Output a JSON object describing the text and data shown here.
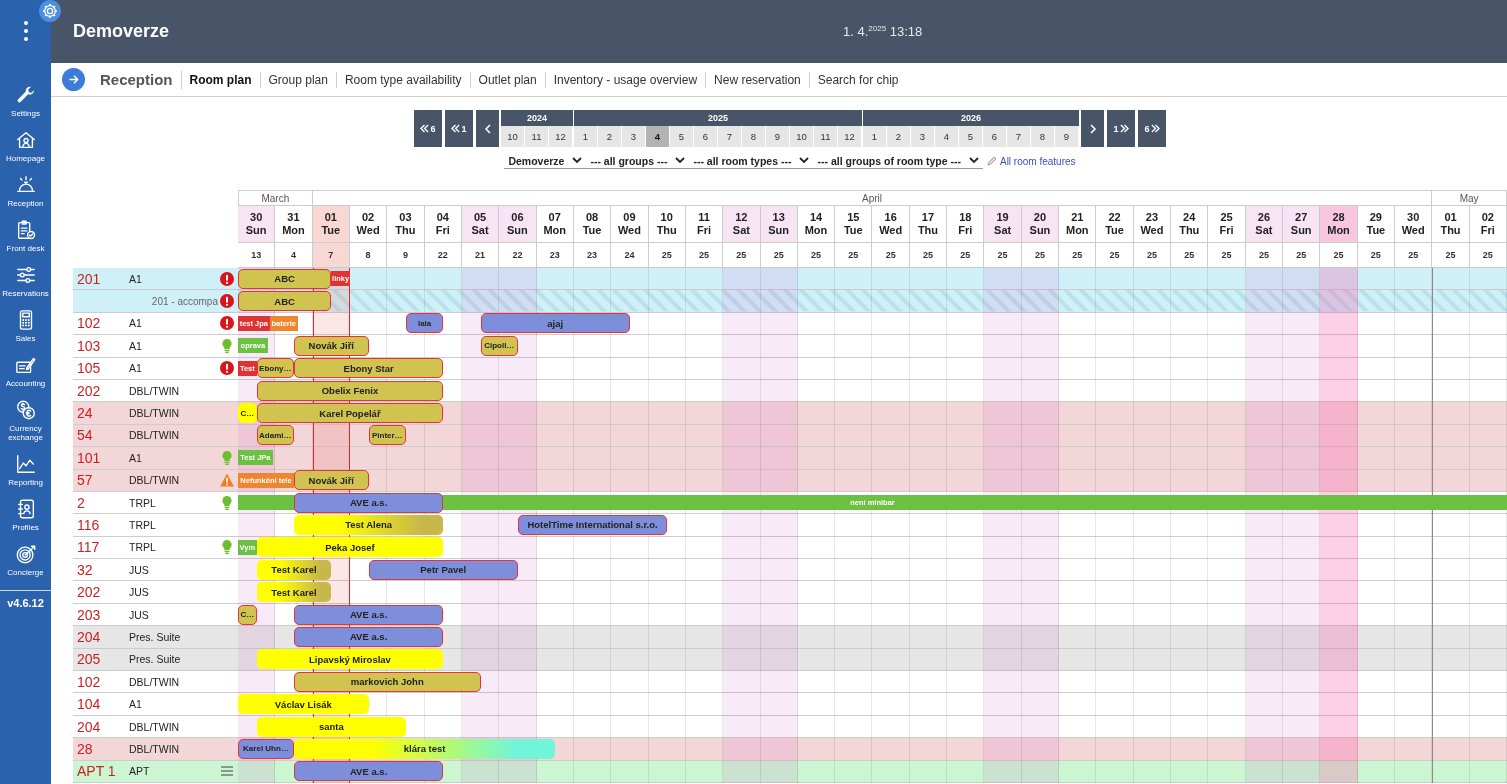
{
  "sidebar": {
    "items": [
      {
        "label": "Settings"
      },
      {
        "label": "Homepage"
      },
      {
        "label": "Reception"
      },
      {
        "label": "Front desk"
      },
      {
        "label": "Reservations"
      },
      {
        "label": "Sales"
      },
      {
        "label": "Accounting"
      },
      {
        "label": "Currency exchange"
      },
      {
        "label": "Reporting"
      },
      {
        "label": "Profiles"
      },
      {
        "label": "Concierge"
      }
    ],
    "version": "v4.6.12"
  },
  "header": {
    "title": "Demoverze",
    "clock": "1. 4.$^{2025}$ 13:18"
  },
  "nav": {
    "section": "Reception",
    "tabs": [
      {
        "label": "Room plan",
        "selected": true
      },
      {
        "label": "Group plan",
        "selected": false
      },
      {
        "label": "Room type availability",
        "selected": false
      },
      {
        "label": "Outlet plan",
        "selected": false
      },
      {
        "label": "Inventory - usage overview",
        "selected": false
      },
      {
        "label": "New reservation",
        "selected": false
      },
      {
        "label": "Search for chip",
        "selected": false
      }
    ]
  },
  "picker": {
    "back": [
      {
        "kind": "jump",
        "label": "6"
      },
      {
        "kind": "jump",
        "label": "1"
      },
      {
        "kind": "step"
      }
    ],
    "years": [
      {
        "year": "2024",
        "months": [
          {
            "label": "10",
            "selected": false
          },
          {
            "label": "11",
            "selected": false
          },
          {
            "label": "12",
            "selected": false
          }
        ]
      },
      {
        "year": "2025",
        "months": [
          {
            "label": "1",
            "selected": false
          },
          {
            "label": "2",
            "selected": false
          },
          {
            "label": "3",
            "selected": false
          },
          {
            "label": "4",
            "selected": true
          },
          {
            "label": "5",
            "selected": false
          },
          {
            "label": "6",
            "selected": false
          },
          {
            "label": "7",
            "selected": false
          },
          {
            "label": "8",
            "selected": false
          },
          {
            "label": "9",
            "selected": false
          },
          {
            "label": "10",
            "selected": false
          },
          {
            "label": "11",
            "selected": false
          },
          {
            "label": "12",
            "selected": false
          }
        ]
      },
      {
        "year": "2026",
        "months": [
          {
            "label": "1",
            "selected": false
          },
          {
            "label": "2",
            "selected": false
          },
          {
            "label": "3",
            "selected": false
          },
          {
            "label": "4",
            "selected": false
          },
          {
            "label": "5",
            "selected": false
          },
          {
            "label": "6",
            "selected": false
          },
          {
            "label": "7",
            "selected": false
          },
          {
            "label": "8",
            "selected": false
          },
          {
            "label": "9",
            "selected": false
          }
        ]
      }
    ],
    "forward": [
      {
        "kind": "step"
      },
      {
        "kind": "jump",
        "label": "1"
      },
      {
        "kind": "jump",
        "label": "6"
      }
    ]
  },
  "filters": {
    "dropdowns": [
      {
        "value": "Demoverze"
      },
      {
        "value": "--- all groups ---"
      },
      {
        "value": "--- all room types ---"
      },
      {
        "value": "--- all groups of room type ---"
      }
    ],
    "features_link": "All room features"
  },
  "grid": {
    "months": [
      {
        "name": "March",
        "days": [
          {
            "day": "30",
            "weekday": "Sun",
            "count": "13",
            "kind": "weekend"
          },
          {
            "day": "31",
            "weekday": "Mon",
            "count": "4",
            "kind": "weekday"
          }
        ]
      },
      {
        "name": "April",
        "days": [
          {
            "day": "01",
            "weekday": "Tue",
            "count": "7",
            "kind": "today"
          },
          {
            "day": "02",
            "weekday": "Wed",
            "count": "8",
            "kind": "weekday"
          },
          {
            "day": "03",
            "weekday": "Thu",
            "count": "9",
            "kind": "weekday"
          },
          {
            "day": "04",
            "weekday": "Fri",
            "count": "22",
            "kind": "weekday"
          },
          {
            "day": "05",
            "weekday": "Sat",
            "count": "21",
            "kind": "weekend"
          },
          {
            "day": "06",
            "weekday": "Sun",
            "count": "22",
            "kind": "weekend"
          },
          {
            "day": "07",
            "weekday": "Mon",
            "count": "23",
            "kind": "weekday"
          },
          {
            "day": "08",
            "weekday": "Tue",
            "count": "23",
            "kind": "weekday"
          },
          {
            "day": "09",
            "weekday": "Wed",
            "count": "24",
            "kind": "weekday"
          },
          {
            "day": "10",
            "weekday": "Thu",
            "count": "25",
            "kind": "weekday"
          },
          {
            "day": "11",
            "weekday": "Fri",
            "count": "25",
            "kind": "weekday"
          },
          {
            "day": "12",
            "weekday": "Sat",
            "count": "25",
            "kind": "weekend"
          },
          {
            "day": "13",
            "weekday": "Sun",
            "count": "25",
            "kind": "weekend"
          },
          {
            "day": "14",
            "weekday": "Mon",
            "count": "25",
            "kind": "weekday"
          },
          {
            "day": "15",
            "weekday": "Tue",
            "count": "25",
            "kind": "weekday"
          },
          {
            "day": "16",
            "weekday": "Wed",
            "count": "25",
            "kind": "weekday"
          },
          {
            "day": "17",
            "weekday": "Thu",
            "count": "25",
            "kind": "weekday"
          },
          {
            "day": "18",
            "weekday": "Fri",
            "count": "25",
            "kind": "weekday"
          },
          {
            "day": "19",
            "weekday": "Sat",
            "count": "25",
            "kind": "weekend"
          },
          {
            "day": "20",
            "weekday": "Sun",
            "count": "25",
            "kind": "weekend"
          },
          {
            "day": "21",
            "weekday": "Mon",
            "count": "25",
            "kind": "weekday"
          },
          {
            "day": "22",
            "weekday": "Tue",
            "count": "25",
            "kind": "weekday"
          },
          {
            "day": "23",
            "weekday": "Wed",
            "count": "25",
            "kind": "weekday"
          },
          {
            "day": "24",
            "weekday": "Thu",
            "count": "25",
            "kind": "weekday"
          },
          {
            "day": "25",
            "weekday": "Fri",
            "count": "25",
            "kind": "weekday"
          },
          {
            "day": "26",
            "weekday": "Sat",
            "count": "25",
            "kind": "weekend"
          },
          {
            "day": "27",
            "weekday": "Sun",
            "count": "25",
            "kind": "weekend"
          },
          {
            "day": "28",
            "weekday": "Mon",
            "count": "25",
            "kind": "holiday"
          },
          {
            "day": "29",
            "weekday": "Tue",
            "count": "25",
            "kind": "weekday"
          },
          {
            "day": "30",
            "weekday": "Wed",
            "count": "25",
            "kind": "weekday"
          }
        ]
      },
      {
        "name": "May",
        "days": [
          {
            "day": "01",
            "weekday": "Thu",
            "count": "25",
            "kind": "weekday"
          },
          {
            "day": "02",
            "weekday": "Fri",
            "count": "25",
            "kind": "weekday"
          }
        ]
      }
    ]
  },
  "rooms": [
    {
      "kind": "room",
      "number": "201",
      "type": "A1",
      "indicator": {
        "kind": "error"
      },
      "color": "#d0f0f8",
      "bars": [
        {
          "kind": "reservation",
          "label": "ABC",
          "color": "#d0c34f",
          "outlined": true
        },
        {
          "kind": "block",
          "label": "linky",
          "color": "#dd3333"
        }
      ]
    },
    {
      "kind": "accompany",
      "label": "201 - accompa",
      "indicator": {
        "kind": "error"
      },
      "color": "#d0f0f8",
      "bars": [
        {
          "kind": "reservation",
          "label": "ABC",
          "color": "#d0c34f",
          "outlined": true
        }
      ]
    },
    {
      "kind": "room",
      "number": "102",
      "type": "A1",
      "indicator": {
        "kind": "error"
      },
      "color": "#ffffff",
      "bars": [
        {
          "kind": "block",
          "label": "test Jpa",
          "color": "#dd3333"
        },
        {
          "kind": "block",
          "label": "baterie",
          "color": "#f08530"
        },
        {
          "kind": "reservation",
          "label": "lala",
          "color": "#7f8edb",
          "outlined": true
        },
        {
          "kind": "reservation",
          "label": "ajaj",
          "color": "#7f8edb",
          "outlined": true
        }
      ]
    },
    {
      "kind": "room",
      "number": "103",
      "type": "A1",
      "indicator": {
        "kind": "tip"
      },
      "color": "#ffffff",
      "bars": [
        {
          "kind": "block",
          "label": "oprava",
          "color": "#6cc143"
        },
        {
          "kind": "reservation",
          "label": "Novák Jiří",
          "color": "#d0c34f",
          "outlined": true
        },
        {
          "kind": "reservation",
          "label": "Cipoll…",
          "color": "#d0c34f",
          "outlined": true
        }
      ]
    },
    {
      "kind": "room",
      "number": "105",
      "type": "A1",
      "indicator": {
        "kind": "error"
      },
      "color": "#ffffff",
      "bars": [
        {
          "kind": "block",
          "label": "Test",
          "color": "#dd3333"
        },
        {
          "kind": "reservation",
          "label": "Ebony…",
          "color": "#d0c34f",
          "outlined": true
        },
        {
          "kind": "reservation",
          "label": "Ebony Star",
          "color": "#d0c34f",
          "outlined": true
        }
      ]
    },
    {
      "kind": "room",
      "number": "202",
      "type": "DBL/TWIN",
      "color": "#ffffff",
      "bars": [
        {
          "kind": "reservation",
          "label": "Obelix Fenix",
          "color": "#d0c34f",
          "outlined": true
        }
      ]
    },
    {
      "kind": "room",
      "number": "24",
      "type": "DBL/TWIN",
      "color": "#f3d6d7",
      "bars": [
        {
          "kind": "reservation",
          "label": "C…",
          "color": "#ffff00",
          "outlined": false
        },
        {
          "kind": "reservation",
          "label": "Karel Popelář",
          "color": "#d0c34f",
          "outlined": true
        }
      ]
    },
    {
      "kind": "room",
      "number": "54",
      "type": "DBL/TWIN",
      "color": "#f3d6d7",
      "bars": [
        {
          "kind": "reservation",
          "label": "Adami…",
          "color": "#d0c34f",
          "outlined": true
        },
        {
          "kind": "reservation",
          "label": "Pinter…",
          "color": "#d0c34f",
          "outlined": true
        }
      ]
    },
    {
      "kind": "room",
      "number": "101",
      "type": "A1",
      "indicator": {
        "kind": "tip"
      },
      "color": "#f3d6d7",
      "bars": [
        {
          "kind": "block",
          "label": "Test JPa",
          "color": "#6cc143"
        }
      ]
    },
    {
      "kind": "room",
      "number": "57",
      "type": "DBL/TWIN",
      "indicator": {
        "kind": "warning"
      },
      "color": "#f3d6d7",
      "bars": [
        {
          "kind": "block",
          "label": "Nefunkční tele",
          "color": "#f08530"
        },
        {
          "kind": "reservation",
          "label": "Novák Jiří",
          "color": "#d0c34f",
          "outlined": true
        }
      ]
    },
    {
      "kind": "room",
      "number": "2",
      "type": "TRPL",
      "indicator": {
        "kind": "tip"
      },
      "color": "#ffffff",
      "bars": [
        {
          "kind": "reservation",
          "label": "AVE a.s.",
          "color": "#7f8edb",
          "outlined": true
        },
        {
          "kind": "block",
          "label": "není minibar",
          "color": "#6cc143"
        }
      ]
    },
    {
      "kind": "room",
      "number": "116",
      "type": "TRPL",
      "color": "#ffffff",
      "bars": [
        {
          "kind": "reservation",
          "label": "Test Alena",
          "color": "#ffff00",
          "fade": {
            "color": "#c8b84a"
          },
          "outlined": false
        },
        {
          "kind": "reservation",
          "label": "HotelTime International s.r.o.",
          "color": "#7f8edb",
          "outlined": true
        }
      ]
    },
    {
      "kind": "room",
      "number": "117",
      "type": "TRPL",
      "indicator": {
        "kind": "tip"
      },
      "color": "#ffffff",
      "bars": [
        {
          "kind": "block",
          "label": "Vym",
          "color": "#6cc143"
        },
        {
          "kind": "reservation",
          "label": "Peka Josef",
          "color": "#ffff00",
          "outlined": false
        }
      ]
    },
    {
      "kind": "room",
      "number": "32",
      "type": "JUS",
      "color": "#ffffff",
      "bars": [
        {
          "kind": "reservation",
          "label": "Test Karel",
          "color": "#ffff00",
          "fade": {
            "color": "#c8b84a"
          },
          "outlined": false
        },
        {
          "kind": "reservation",
          "label": "Petr Pavel",
          "color": "#7f8edb",
          "outlined": true
        }
      ]
    },
    {
      "kind": "room",
      "number": "202",
      "type": "JUS",
      "color": "#ffffff",
      "bars": [
        {
          "kind": "reservation",
          "label": "Test Karel",
          "color": "#ffff00",
          "fade": {
            "color": "#c8b84a"
          },
          "outlined": false
        }
      ]
    },
    {
      "kind": "room",
      "number": "203",
      "type": "JUS",
      "color": "#ffffff",
      "bars": [
        {
          "kind": "reservation",
          "label": "C…",
          "color": "#d0c34f",
          "outlined": true
        },
        {
          "kind": "reservation",
          "label": "AVE a.s.",
          "color": "#7f8edb",
          "outlined": true
        }
      ]
    },
    {
      "kind": "room",
      "number": "204",
      "type": "Pres. Suite",
      "color": "#e6e6e6",
      "bars": [
        {
          "kind": "reservation",
          "label": "AVE a.s.",
          "color": "#7f8edb",
          "outlined": true
        }
      ]
    },
    {
      "kind": "room",
      "number": "205",
      "type": "Pres. Suite",
      "color": "#e6e6e6",
      "bars": [
        {
          "kind": "reservation",
          "label": "Lipavský Miroslav",
          "color": "#ffff00",
          "outlined": false
        }
      ]
    },
    {
      "kind": "room",
      "number": "102",
      "type": "DBL/TWIN",
      "color": "#ffffff",
      "bars": [
        {
          "kind": "reservation",
          "label": "markovich John",
          "color": "#d0c34f",
          "outlined": true
        }
      ]
    },
    {
      "kind": "room",
      "number": "104",
      "type": "A1",
      "color": "#ffffff",
      "bars": [
        {
          "kind": "reservation",
          "label": "Václav Lisák",
          "color": "#ffff00",
          "outlined": false
        }
      ]
    },
    {
      "kind": "room",
      "number": "204",
      "type": "DBL/TWIN",
      "color": "#ffffff",
      "bars": [
        {
          "kind": "reservation",
          "label": "santa",
          "color": "#ffff00",
          "outlined": false
        }
      ]
    },
    {
      "kind": "room",
      "number": "28",
      "type": "DBL/TWIN",
      "color": "#f3d6d7",
      "bars": [
        {
          "kind": "reservation",
          "label": "Karel Uhn…",
          "color": "#7f8edb",
          "outlined": true
        },
        {
          "kind": "reservation",
          "label": "klára test",
          "color": "#ffff00",
          "fade": {
            "color": "#70f5d8"
          },
          "outlined": false
        }
      ]
    },
    {
      "kind": "room",
      "number": "APT 1",
      "type": "APT",
      "indicator": {
        "kind": "list"
      },
      "color": "#ccf6d2",
      "bars": [
        {
          "kind": "reservation",
          "label": "AVE a.s.",
          "color": "#7f8edb",
          "outlined": true
        }
      ]
    }
  ]
}
